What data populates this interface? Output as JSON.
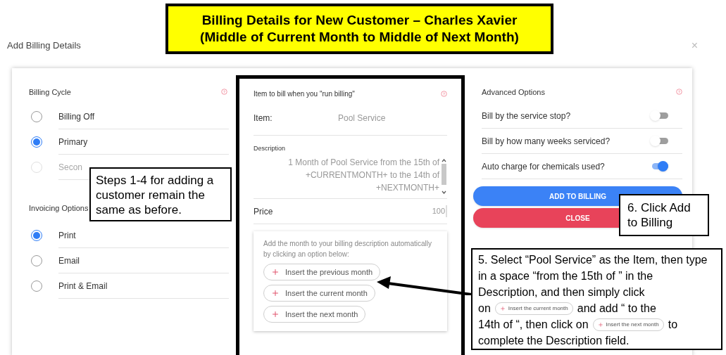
{
  "banner": {
    "lines": [
      "Billing Details for New Customer – Charles Xavier",
      "(Middle of Current Month to Middle of Next Month)"
    ]
  },
  "dialog": {
    "title": "Add Billing Details",
    "close": "×"
  },
  "billing_cycle": {
    "title": "Billing Cycle",
    "options": [
      {
        "label": "Billing Off",
        "selected": false,
        "disabled": false
      },
      {
        "label": "Primary",
        "selected": true,
        "disabled": false
      },
      {
        "label": "Secon",
        "selected": false,
        "disabled": true
      }
    ]
  },
  "invoicing": {
    "title": "Invoicing Options",
    "options": [
      {
        "label": "Print",
        "selected": true
      },
      {
        "label": "Email",
        "selected": false
      },
      {
        "label": "Print & Email",
        "selected": false
      }
    ]
  },
  "item_panel": {
    "title": "Item to bill when you \"run billing\"",
    "item_label": "Item:",
    "item_value": "Pool Service",
    "description_label": "Description",
    "description": "1 Month of Pool Service from the 15th of +CURRENTMONTH+ to the 14th of +NEXTMONTH+",
    "price_label": "Price",
    "price": "100",
    "helper": "Add the month to your billing description automatically by clicking an option below:",
    "insert_buttons": [
      "Insert the previous month",
      "Insert the current month",
      "Insert the next month"
    ]
  },
  "advanced": {
    "title": "Advanced Options",
    "toggles": [
      {
        "label": "Bill by the service stop?",
        "on": false
      },
      {
        "label": "Bill by how many weeks serviced?",
        "on": false
      },
      {
        "label": "Auto charge for chemicals used?",
        "on": true
      }
    ],
    "buttons": [
      {
        "label": "ADD TO BILLING",
        "kind": "primary"
      },
      {
        "label": "CLOSE",
        "kind": "danger"
      }
    ]
  },
  "callouts": [
    {
      "lines": [
        [
          {
            "kind": "text",
            "text": "Steps 1-4 for adding a customer remain the same as before."
          }
        ]
      ]
    },
    {
      "lines": [
        [
          {
            "kind": "text",
            "text": "6. Click Add to Billing"
          }
        ]
      ]
    },
    {
      "lines": [
        [
          {
            "kind": "text",
            "text": "5. Select “Pool Service” as the Item, then type in a space “from the 15th of ” in the Description, and then simply click"
          }
        ],
        [
          {
            "kind": "text",
            "text": "on"
          },
          {
            "kind": "chip",
            "text": "Insert the current month"
          },
          {
            "kind": "text",
            "text": "and add “ to the"
          }
        ],
        [
          {
            "kind": "text",
            "text": "14th of “, then click on"
          },
          {
            "kind": "chip",
            "text": "Insert the next month"
          },
          {
            "kind": "text",
            "text": "to"
          }
        ],
        [
          {
            "kind": "text",
            "text": "complete the Description field."
          }
        ]
      ]
    }
  ]
}
